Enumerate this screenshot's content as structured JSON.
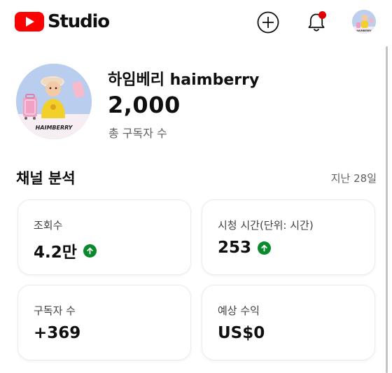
{
  "app": {
    "logo_text": "Studio",
    "brand_color": "#ff0000"
  },
  "header": {
    "create_icon": "plus-circle-icon",
    "notification_icon": "bell-icon",
    "notification_dot_color": "#e00000"
  },
  "channel": {
    "name": "하임베리 haimberry",
    "subscriber_count": "2,000",
    "subscriber_label": "총 구독자 수",
    "avatar_caption": "HAIMBERRY"
  },
  "analytics": {
    "title": "채널 분석",
    "period": "지난 28일",
    "trend_up_color": "#0a8a2c",
    "cards": [
      {
        "label": "조회수",
        "value": "4.2만",
        "trend": "up"
      },
      {
        "label": "시청 시간(단위: 시간)",
        "value": "253",
        "trend": "up"
      },
      {
        "label": "구독자 수",
        "value": "+369",
        "trend": "none"
      },
      {
        "label": "예상 수익",
        "value": "US$0",
        "trend": "none"
      }
    ]
  }
}
